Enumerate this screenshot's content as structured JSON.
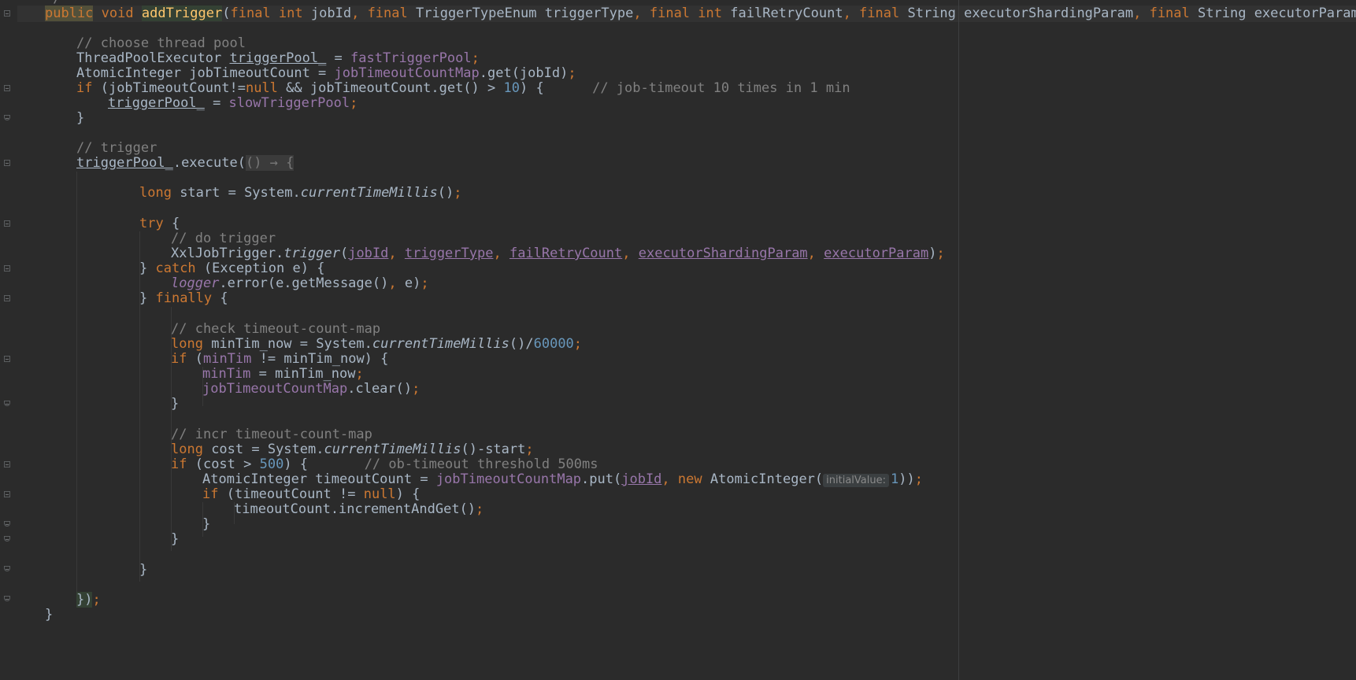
{
  "editor": {
    "lines": {
      "signature": {
        "kw_public": "public",
        "kw_void": "void",
        "method": "addTrigger",
        "p1_final": "final",
        "p1_type": "int",
        "p1_name": "jobId",
        "p2_final": "final",
        "p2_type": "TriggerTypeEnum",
        "p2_name": "triggerType",
        "p3_final": "final",
        "p3_type": "int",
        "p3_name": "failRetryCount",
        "p4_final": "final",
        "p4_type": "String",
        "p4_name": "executorShardingParam",
        "p5_final": "final",
        "p5_type": "String",
        "p5_name": "executorParam",
        "tail": ") {"
      },
      "c_choose_pool": "// choose thread pool",
      "pool_decl": {
        "type": "ThreadPoolExecutor",
        "var": "triggerPool_",
        "eq": " = ",
        "field": "fastTriggerPool",
        "semi": ";"
      },
      "count_decl": {
        "prefix": "AtomicInteger jobTimeoutCount = ",
        "field": "jobTimeoutCountMap",
        "suffix": ".get(jobId)",
        "semi": ";"
      },
      "if_timeout": {
        "kw_if": "if",
        "part1": " (jobTimeoutCount!=",
        "kw_null": "null",
        "part2": " && jobTimeoutCount.get() > ",
        "num": "10",
        "part3": ") {      ",
        "comment": "// job-timeout 10 times in 1 min"
      },
      "slow_assign": {
        "var": "triggerPool_",
        "eq": " = ",
        "field": "slowTriggerPool",
        "semi": ";"
      },
      "close1": "}",
      "c_trigger": "// trigger",
      "execute": {
        "var": "triggerPool_",
        "call": ".execute(",
        "lambda": "() → {"
      },
      "start_decl": {
        "kw": "long",
        "text": " start = System.",
        "method": "currentTimeMillis",
        "end": "()",
        "semi": ";"
      },
      "try_line": {
        "kw": "try",
        "rest": " {"
      },
      "c_do_trigger": "// do trigger",
      "trigger_call": {
        "cls": "XxlJobTrigger.",
        "method": "trigger",
        "open": "(",
        "a1": "jobId",
        "a2": "triggerType",
        "a3": "failRetryCount",
        "a4": "executorShardingParam",
        "a5": "executorParam",
        "close": ")",
        "semi": ";"
      },
      "catch_line": {
        "brace": "} ",
        "kw": "catch",
        "rest": " (Exception e) {"
      },
      "logger_line": {
        "field": "logger",
        "rest": ".error(e.getMessage()",
        "comma": ", ",
        "rest2": "e)",
        "semi": ";"
      },
      "finally_line": {
        "brace": "} ",
        "kw": "finally",
        "rest": " {"
      },
      "c_check_map": "// check timeout-count-map",
      "mintim_decl": {
        "kw": "long",
        "text": " minTim_now = System.",
        "method": "currentTimeMillis",
        "mid": "()/",
        "num": "60000",
        "semi": ";"
      },
      "if_mintim": {
        "kw": "if",
        "p1": " (",
        "field": "minTim",
        "p2": " != minTim_now) {"
      },
      "mintim_assign": {
        "field": "minTim",
        "rest": " = minTim_now",
        "semi": ";"
      },
      "clear_line": {
        "field": "jobTimeoutCountMap",
        "rest": ".clear()",
        "semi": ";"
      },
      "close2": "}",
      "c_incr_map": "// incr timeout-count-map",
      "cost_decl": {
        "kw": "long",
        "text": " cost = System.",
        "method": "currentTimeMillis",
        "rest": "()-start",
        "semi": ";"
      },
      "if_cost": {
        "kw": "if",
        "p1": " (cost > ",
        "num": "500",
        "p2": ") {       ",
        "comment": "// ob-timeout threshold 500ms"
      },
      "put_line": {
        "prefix": "AtomicInteger timeoutCount = ",
        "field": "jobTimeoutCountMap",
        "call": ".put(",
        "arg": "jobId",
        "comma": ", ",
        "kw_new": "new",
        "ctor": " AtomicInteger(",
        "hint": "initialValue:",
        "num": "1",
        "close": "))",
        "semi": ";"
      },
      "if_null": {
        "kw": "if",
        "p1": " (timeoutCount != ",
        "kw_null": "null",
        "p2": ") {"
      },
      "incr_line": {
        "text": "timeoutCount.incrementAndGet()",
        "semi": ";"
      },
      "close3": "}",
      "close4": "}",
      "close5": "}",
      "end_exec": {
        "brace": "})",
        "semi": ";"
      },
      "close_method": "}",
      "top_partial": "*/"
    }
  }
}
